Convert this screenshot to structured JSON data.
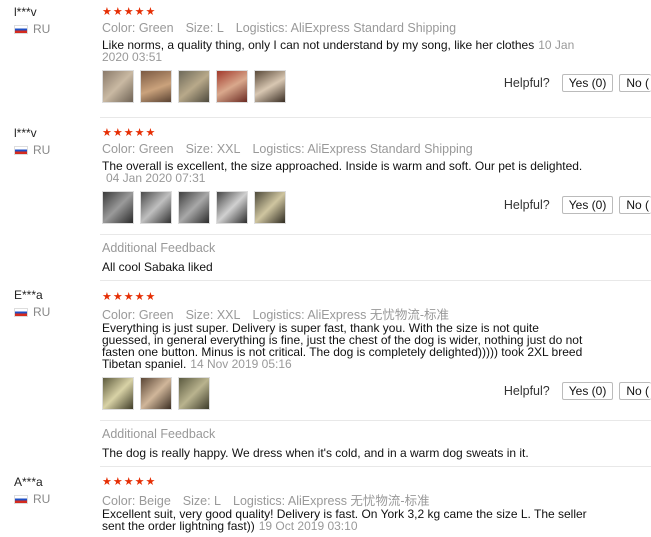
{
  "reviews": [
    {
      "user": "l***v",
      "country": "RU",
      "stars": "★★★★★",
      "meta": [
        "Color: Green",
        "Size: L",
        "Logistics: AliExpress Standard Shipping"
      ],
      "text_lines": [
        "Like norms, a quality thing, only I can not understand by my song, like her clothes"
      ],
      "date_inline": "10 Jan",
      "date_tail": "2020 03:51",
      "helpful_label": "Helpful?",
      "yes": "Yes (0)",
      "no": "No ("
    },
    {
      "user": "l***v",
      "country": "RU",
      "stars": "★★★★★",
      "meta": [
        "Color: Green",
        "Size: XXL",
        "Logistics: AliExpress Standard Shipping"
      ],
      "text_lines": [
        "The overall is excellent, the size approached. Inside is warm and soft. Our pet is delighted."
      ],
      "date_tail": "04 Jan 2020 07:31",
      "helpful_label": "Helpful?",
      "yes": "Yes (0)",
      "no": "No (",
      "feedback_label": "Additional Feedback",
      "feedback_text": "All cool Sabaka liked"
    },
    {
      "user": "E***a",
      "country": "RU",
      "stars": "★★★★★",
      "meta": [
        "Color: Green",
        "Size: XXL",
        "Logistics: AliExpress 无忧物流-标准"
      ],
      "text_lines": [
        "Everything is just super. Delivery is super fast, thank you. With the size is not quite",
        "guessed, in general everything is fine, just the chest of the dog is wider, nothing just do not",
        "fasten one button. Minus is not critical. The dog is completely delighted))))) took 2XL breed",
        "Tibetan spaniel."
      ],
      "date_inline": "14 Nov 2019 05:16",
      "helpful_label": "Helpful?",
      "yes": "Yes (0)",
      "no": "No (",
      "feedback_label": "Additional Feedback",
      "feedback_text": "The dog is really happy. We dress when it's cold, and in a warm dog sweats in it."
    },
    {
      "user": "A***a",
      "country": "RU",
      "stars": "★★★★★",
      "meta": [
        "Color: Beige",
        "Size: L",
        "Logistics: AliExpress 无忧物流-标准"
      ],
      "text_lines": [
        "Excellent suit, very good quality! Delivery is fast. On York 3,2 kg came the size L. The seller",
        "sent the order lightning fast))"
      ],
      "date_inline": "19 Oct 2019 03:10"
    }
  ],
  "colors": {
    "stars": "#e62e04",
    "muted": "#999999"
  }
}
